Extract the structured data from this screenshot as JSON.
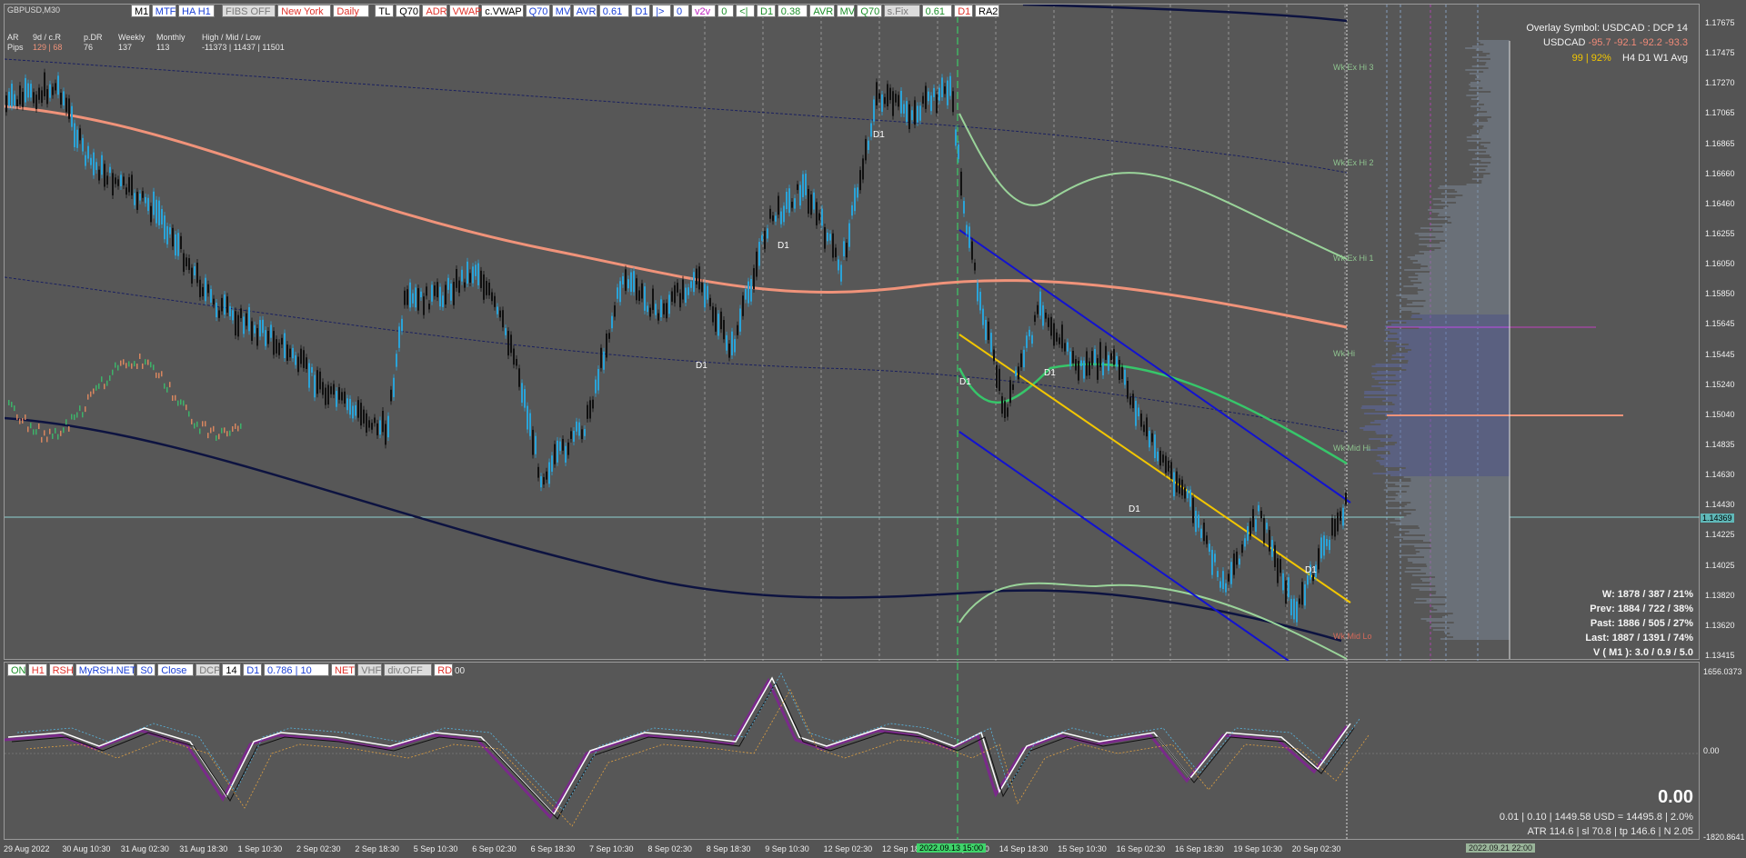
{
  "symbol_title": "GBPUSD,M30",
  "toolbar": [
    {
      "label": "M1",
      "bg": "#ffffff",
      "fg": "#000000"
    },
    {
      "label": "MTF",
      "bg": "#ffffff",
      "fg": "#1a3fd6"
    },
    {
      "label": "HA H1",
      "bg": "#ffffff",
      "fg": "#1a3fd6"
    },
    {
      "label": "FIBS OFF",
      "bg": "#dcdcdc",
      "fg": "#7a7a7a"
    },
    {
      "label": "New York",
      "bg": "#ffffff",
      "fg": "#e0322b"
    },
    {
      "label": "Daily",
      "bg": "#ffffff",
      "fg": "#e0322b"
    },
    {
      "label": "TL",
      "bg": "#ffffff",
      "fg": "#000000"
    },
    {
      "label": "Q70",
      "bg": "#ffffff",
      "fg": "#000000"
    },
    {
      "label": "ADR",
      "bg": "#ffffff",
      "fg": "#e0322b"
    },
    {
      "label": "VWAP",
      "bg": "#ffffff",
      "fg": "#e0322b"
    },
    {
      "label": "c.VWAP",
      "bg": "#ffffff",
      "fg": "#000000"
    },
    {
      "label": "Q70",
      "bg": "#ffffff",
      "fg": "#1a3fd6"
    },
    {
      "label": "MV",
      "bg": "#ffffff",
      "fg": "#1a3fd6"
    },
    {
      "label": "AVR",
      "bg": "#ffffff",
      "fg": "#1a3fd6"
    },
    {
      "label": "0.61",
      "bg": "#ffffff",
      "fg": "#1a3fd6"
    },
    {
      "label": "D1",
      "bg": "#ffffff",
      "fg": "#1a3fd6"
    },
    {
      "label": "|>",
      "bg": "#ffffff",
      "fg": "#1a3fd6"
    },
    {
      "label": "0",
      "bg": "#ffffff",
      "fg": "#1a3fd6"
    },
    {
      "label": "v2v",
      "bg": "#ffffff",
      "fg": "#c020c0"
    },
    {
      "label": "0",
      "bg": "#ffffff",
      "fg": "#1c8f2a"
    },
    {
      "label": "<|",
      "bg": "#ffffff",
      "fg": "#1c8f2a"
    },
    {
      "label": "D1",
      "bg": "#ffffff",
      "fg": "#1c8f2a"
    },
    {
      "label": "0.38",
      "bg": "#ffffff",
      "fg": "#1c8f2a"
    },
    {
      "label": "AVR",
      "bg": "#ffffff",
      "fg": "#1c8f2a"
    },
    {
      "label": "MV",
      "bg": "#ffffff",
      "fg": "#1c8f2a"
    },
    {
      "label": "Q70",
      "bg": "#ffffff",
      "fg": "#1c8f2a"
    },
    {
      "label": "s.Fix",
      "bg": "#dcdcdc",
      "fg": "#7a7a7a"
    },
    {
      "label": "0.61",
      "bg": "#ffffff",
      "fg": "#1c8f2a"
    },
    {
      "label": "D1",
      "bg": "#ffffff",
      "fg": "#e0322b"
    },
    {
      "label": "RA2",
      "bg": "#ffffff",
      "fg": "#000000"
    }
  ],
  "info_table": {
    "row1": [
      "AR",
      "9d / c.R",
      "p.DR",
      "Weekly",
      "Monthly",
      "High / Mid / Low"
    ],
    "row2": [
      "Pips",
      "129 | 68",
      "76",
      "137",
      "113",
      "-11373  |  11437  |  11501"
    ]
  },
  "overlay": {
    "line1": "Overlay Symbol: USDCAD : DCP 14",
    "line2_symbol": "USDCAD",
    "line2_values": "-95.7  -92.1  -92.2  -93.3",
    "line3_values": "99 | 92%",
    "line3_tfs": "H4    D1    W1    Avg"
  },
  "stats": [
    "W: 1878 / 387 / 21%",
    "Prev: 1884 / 722 / 38%",
    "Past: 1886 / 505 / 27%",
    "Last: 1887 / 1391 / 74%",
    "V ( M1 ): 3.0 / 0.9 / 5.0"
  ],
  "levels": [
    "Wk Ex Hi 3",
    "Wk Ex Hi 2",
    "Wk Ex Hi 1",
    "Wk Hi",
    "Wk Mid Hi",
    "Wk Mid Lo"
  ],
  "d1_tag": "D1",
  "price_axis": [
    "1.17675",
    "1.17475",
    "1.17270",
    "1.17065",
    "1.16865",
    "1.16660",
    "1.16460",
    "1.16255",
    "1.16050",
    "1.15850",
    "1.15645",
    "1.15445",
    "1.15240",
    "1.15040",
    "1.14835",
    "1.14630",
    "1.14430",
    "1.14225",
    "1.14025",
    "1.13820",
    "1.13620",
    "1.13415"
  ],
  "current_price": "1.14369",
  "time_axis": [
    "29 Aug 2022",
    "30 Aug 10:30",
    "31 Aug 02:30",
    "31 Aug 18:30",
    "1 Sep 10:30",
    "2 Sep 02:30",
    "2 Sep 18:30",
    "5 Sep 10:30",
    "6 Sep 02:30",
    "6 Sep 18:30",
    "7 Sep 10:30",
    "8 Sep 02:30",
    "8 Sep 18:30",
    "9 Sep 10:30",
    "12 Sep 02:30",
    "12 Sep 18",
    "14 Sep 02:30",
    "14 Sep 18:30",
    "15 Sep 10:30",
    "16 Sep 02:30",
    "16 Sep 18:30",
    "19 Sep 10:30",
    "20 Sep 02:30"
  ],
  "time_marker": "2022.09.13 15:00",
  "time_marker_right": "2022.09.21 22:00",
  "sub_toolbar": [
    {
      "label": "ON",
      "bg": "#ffffff",
      "fg": "#1c8f2a"
    },
    {
      "label": "H1",
      "bg": "#ffffff",
      "fg": "#e0322b"
    },
    {
      "label": "RSH",
      "bg": "#ffffff",
      "fg": "#e0322b"
    },
    {
      "label": "MyRSH.NET",
      "bg": "#ffffff",
      "fg": "#1a3fd6"
    },
    {
      "label": "S0",
      "bg": "#ffffff",
      "fg": "#1a3fd6"
    },
    {
      "label": "Close",
      "bg": "#ffffff",
      "fg": "#1a3fd6"
    },
    {
      "label": "DCP",
      "bg": "#dcdcdc",
      "fg": "#7a7a7a"
    },
    {
      "label": "14",
      "bg": "#ffffff",
      "fg": "#000000"
    },
    {
      "label": "D1",
      "bg": "#ffffff",
      "fg": "#1a3fd6"
    },
    {
      "label": "0.786 | 10",
      "bg": "#ffffff",
      "fg": "#1a3fd6"
    },
    {
      "label": "NET",
      "bg": "#ffffff",
      "fg": "#e0322b"
    },
    {
      "label": "VHF",
      "bg": "#dcdcdc",
      "fg": "#7a7a7a"
    },
    {
      "label": "div.OFF",
      "bg": "#dcdcdc",
      "fg": "#7a7a7a"
    },
    {
      "label": "RD",
      "bg": "#ffffff",
      "fg": "#e0322b"
    }
  ],
  "sub_toolbar_tail": "00",
  "sub_axis": [
    "1656.0373",
    "0.00",
    "-1820.8641"
  ],
  "sub_readout": {
    "big": "0.00",
    "line1": "0.01  |  0.10  |  1449.58 USD = 14495.8  |  2.0%",
    "line2": "ATR 114.6  |  sl 70.8  |  tp 146.6  |  N 2.05"
  },
  "colors": {
    "bg": "#575757",
    "bull": "#2aa3d8",
    "bear": "#111111",
    "ma_salmon": "#f0937a",
    "navy": "#0d1340",
    "green": "#37c66a",
    "channel": "#1212d0",
    "yellow": "#f2c600"
  },
  "chart_data": {
    "type": "candlestick",
    "symbol": "GBPUSD",
    "timeframe": "M30"
  }
}
